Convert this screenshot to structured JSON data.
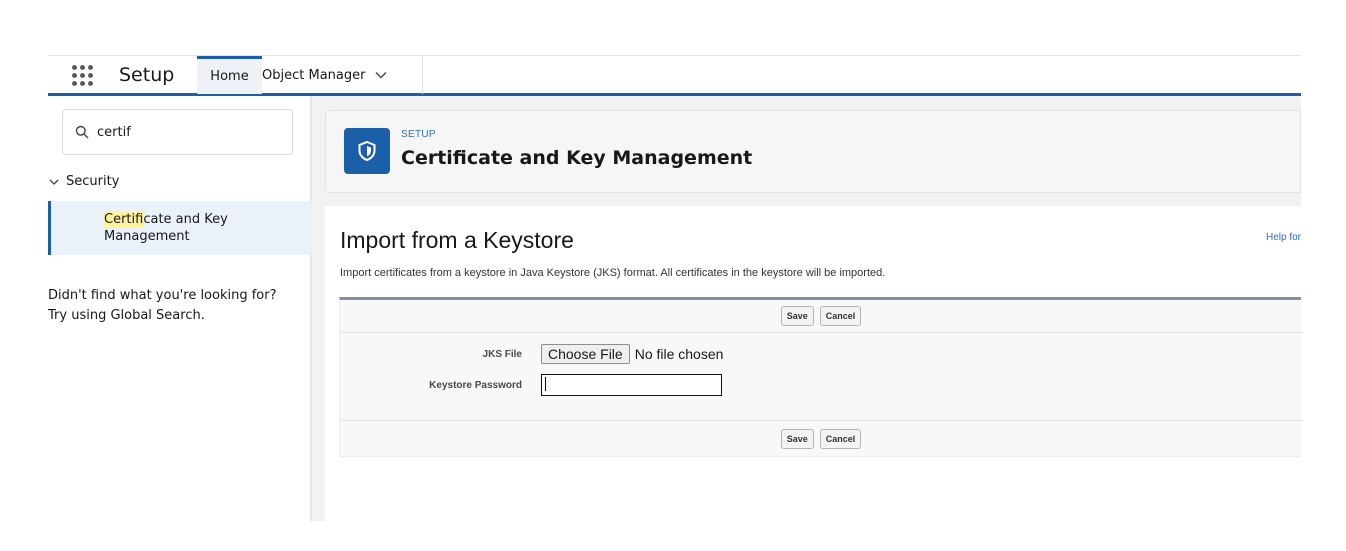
{
  "nav": {
    "app_title": "Setup",
    "tabs": [
      {
        "label": "Home"
      },
      {
        "label": "Object Manager"
      }
    ]
  },
  "sidebar": {
    "search_value": "certif",
    "section": "Security",
    "item_highlight": "Certif",
    "item_rest": "icate and Key",
    "item_line2": "Management",
    "no_find_line1": "Didn't find what you're looking for?",
    "no_find_line2": "Try using Global Search."
  },
  "header": {
    "eyebrow": "SETUP",
    "title": "Certificate and Key Management"
  },
  "content": {
    "page_title": "Import from a Keystore",
    "help_link": "Help for",
    "description": "Import certificates from a keystore in Java Keystore (JKS) format. All certificates in the keystore will be imported.",
    "save_label": "Save",
    "cancel_label": "Cancel",
    "jks_label": "JKS File",
    "choose_file_label": "Choose File",
    "no_file_text": "No file chosen",
    "password_label": "Keystore Password",
    "password_value": ""
  },
  "colors": {
    "brand_blue": "#1b5fa8",
    "link_blue": "#2f6fb6",
    "highlight": "#fff49c"
  },
  "icons": [
    "app-launcher-icon",
    "chevron-down-icon",
    "search-icon",
    "shield-icon"
  ]
}
